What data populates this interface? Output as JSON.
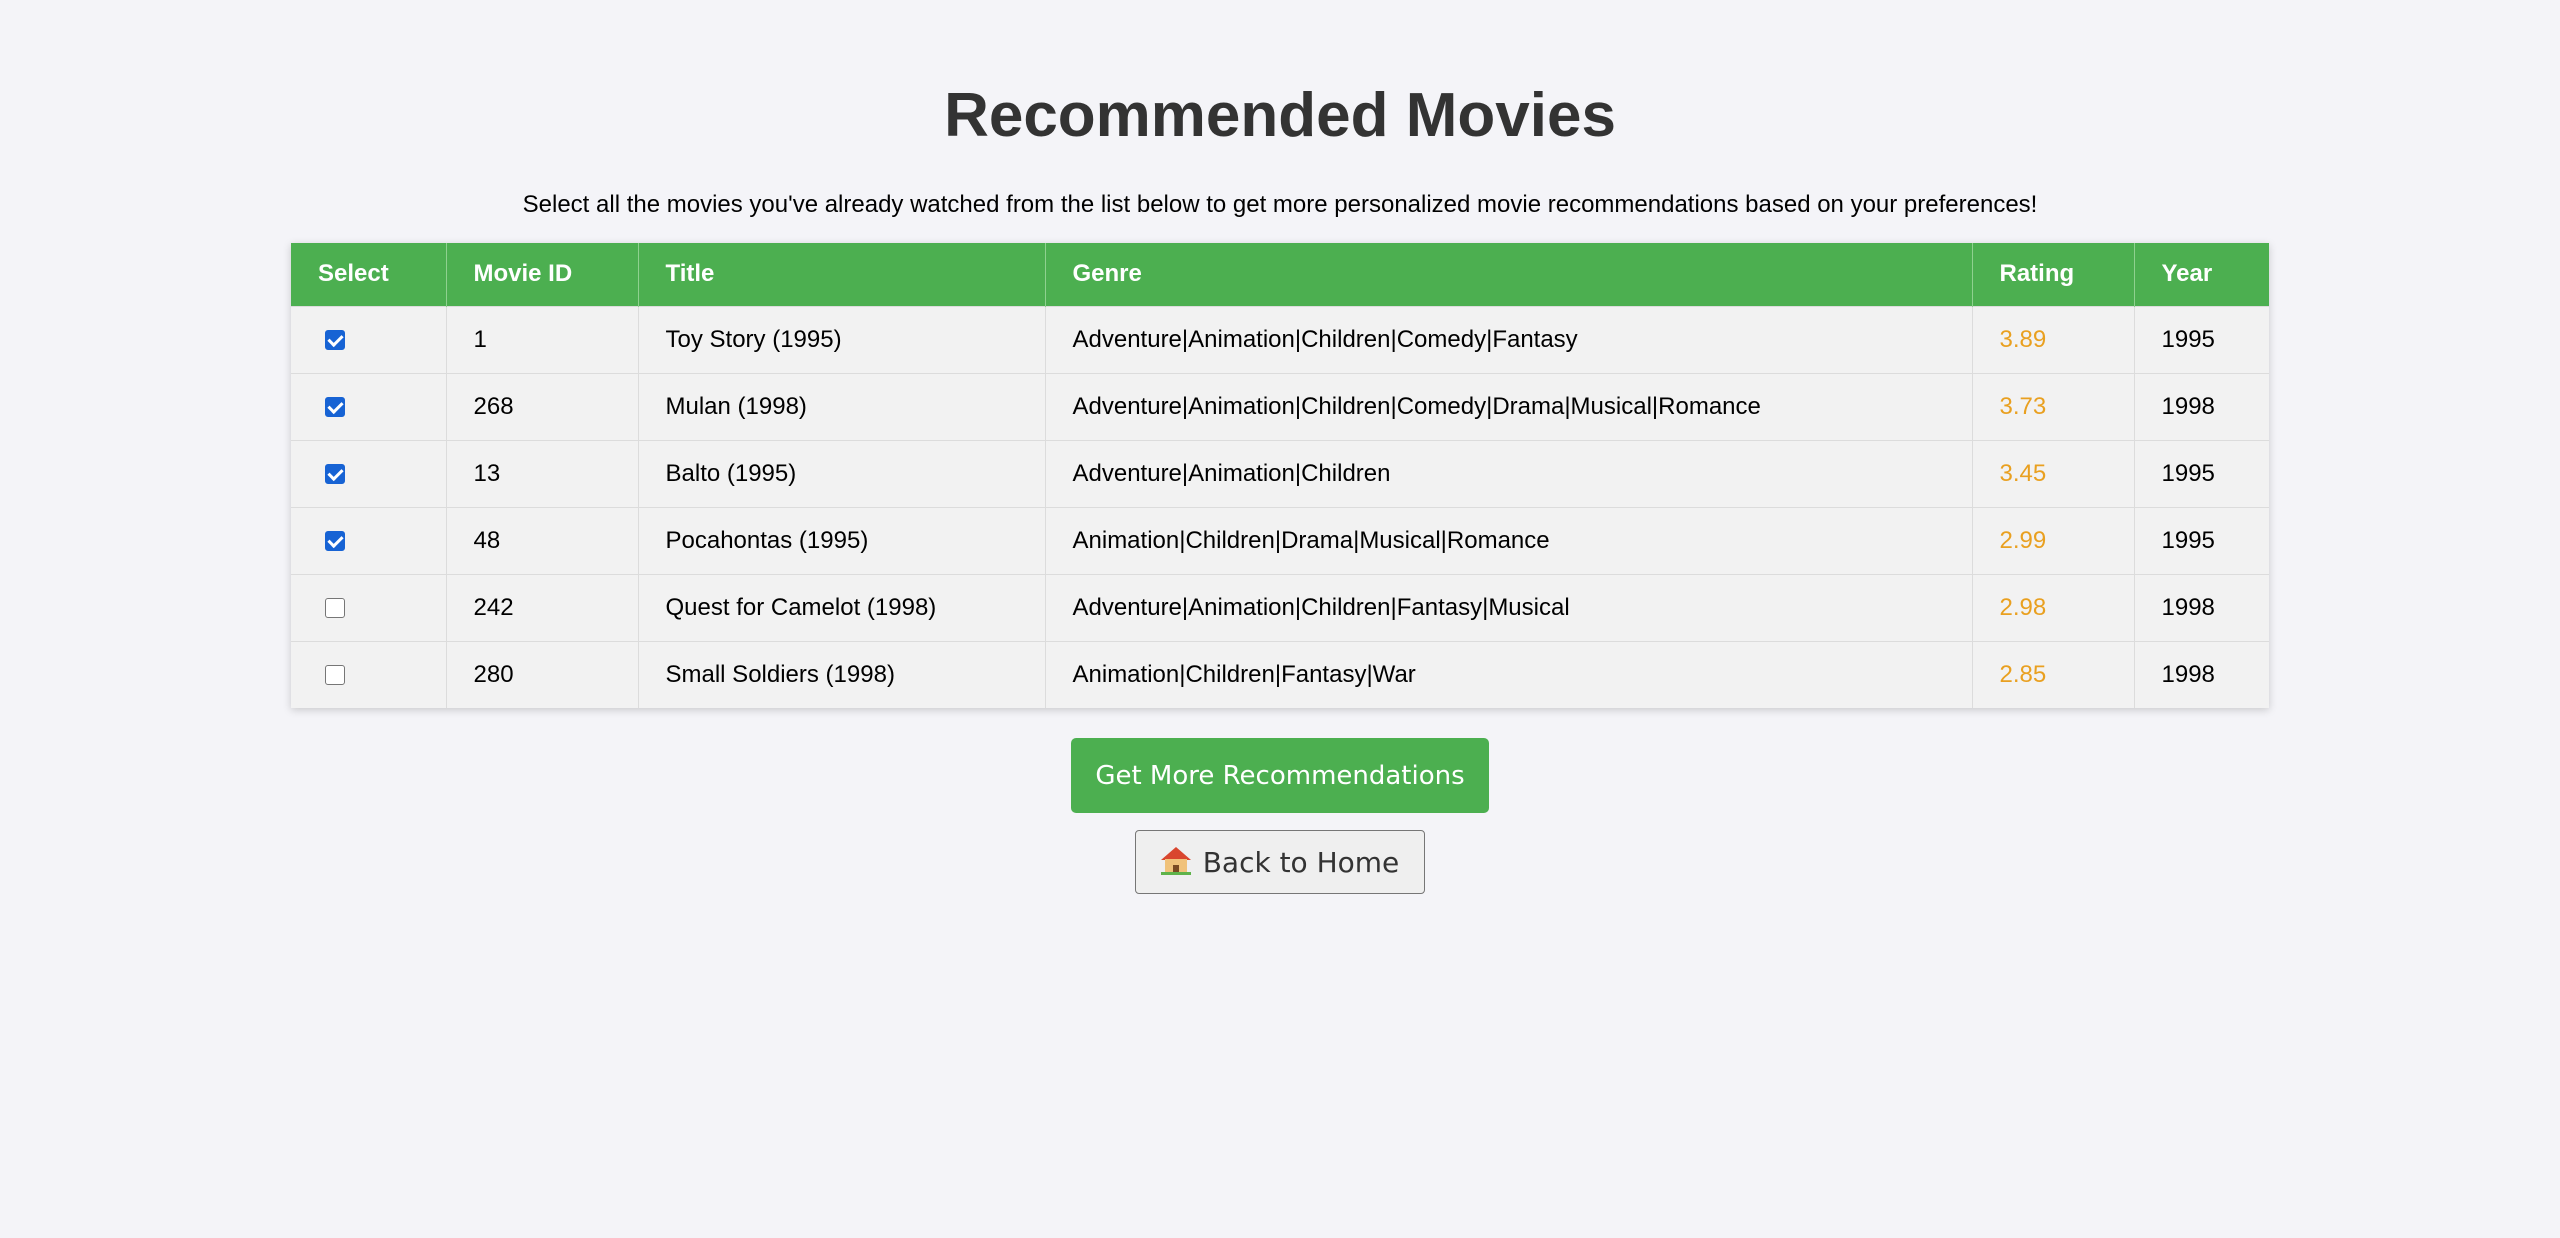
{
  "page": {
    "title": "Recommended Movies",
    "intro": "Select all the movies you've already watched from the list below to get more personalized movie recommendations based on your preferences!"
  },
  "table": {
    "headers": {
      "select": "Select",
      "movie_id": "Movie ID",
      "title": "Title",
      "genre": "Genre",
      "rating": "Rating",
      "year": "Year"
    },
    "rows": [
      {
        "checked": true,
        "movie_id": "1",
        "title": "Toy Story (1995)",
        "genre": "Adventure|Animation|Children|Comedy|Fantasy",
        "rating": "3.89",
        "year": "1995"
      },
      {
        "checked": true,
        "movie_id": "268",
        "title": "Mulan (1998)",
        "genre": "Adventure|Animation|Children|Comedy|Drama|Musical|Romance",
        "rating": "3.73",
        "year": "1998"
      },
      {
        "checked": true,
        "movie_id": "13",
        "title": "Balto (1995)",
        "genre": "Adventure|Animation|Children",
        "rating": "3.45",
        "year": "1995"
      },
      {
        "checked": true,
        "movie_id": "48",
        "title": "Pocahontas (1995)",
        "genre": "Animation|Children|Drama|Musical|Romance",
        "rating": "2.99",
        "year": "1995"
      },
      {
        "checked": false,
        "movie_id": "242",
        "title": "Quest for Camelot (1998)",
        "genre": "Adventure|Animation|Children|Fantasy|Musical",
        "rating": "2.98",
        "year": "1998"
      },
      {
        "checked": false,
        "movie_id": "280",
        "title": "Small Soldiers (1998)",
        "genre": "Animation|Children|Fantasy|War",
        "rating": "2.85",
        "year": "1998"
      }
    ]
  },
  "actions": {
    "recommend_label": "Get More Recommendations",
    "home_label": "Back to Home",
    "home_icon": "house-icon"
  },
  "colors": {
    "header_bg": "#4caf50",
    "button_bg": "#4caf50",
    "rating_text": "#e9a020",
    "checkbox_checked": "#1763d4",
    "page_bg": "#f4f4f8"
  }
}
